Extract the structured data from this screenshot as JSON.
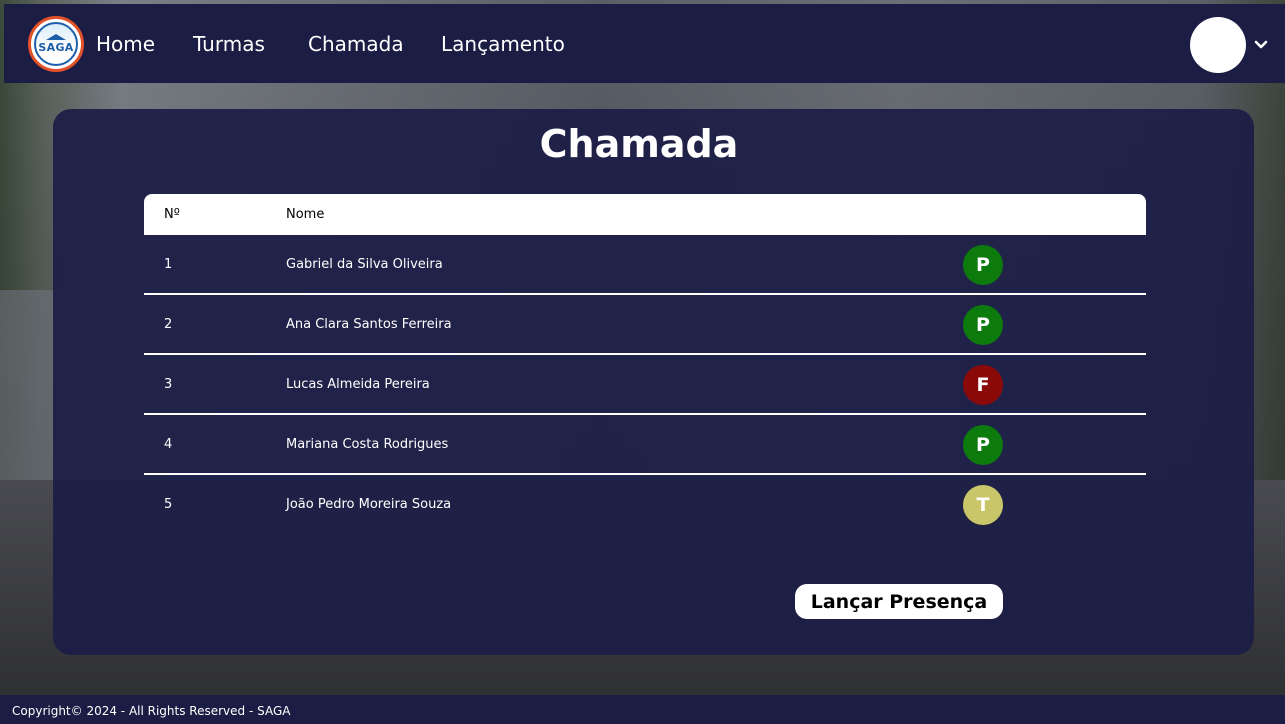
{
  "nav": {
    "logo_text": "SAGA",
    "links": [
      "Home",
      "Turmas",
      "Chamada",
      "Lançamento"
    ]
  },
  "page": {
    "title": "Chamada"
  },
  "table": {
    "headers": {
      "num": "Nº",
      "name": "Nome"
    },
    "rows": [
      {
        "num": "1",
        "name": "Gabriel da Silva Oliveira",
        "status": "P"
      },
      {
        "num": "2",
        "name": "Ana Clara Santos Ferreira",
        "status": "P"
      },
      {
        "num": "3",
        "name": "Lucas Almeida Pereira",
        "status": "F"
      },
      {
        "num": "4",
        "name": "Mariana Costa Rodrigues",
        "status": "P"
      },
      {
        "num": "5",
        "name": "João Pedro Moreira Souza",
        "status": "T"
      }
    ]
  },
  "status_colors": {
    "P": "#0d7a0d",
    "F": "#8a0a0a",
    "T": "#c9c66a"
  },
  "actions": {
    "submit_label": "Lançar Presença"
  },
  "footer": {
    "text": "Copyright© 2024 - All Rights Reserved - SAGA"
  },
  "colors": {
    "navbar": "#1c1d45",
    "panel": "#1c1d46"
  },
  "icons": {
    "user_menu": "chevron-down-icon",
    "avatar": "avatar"
  }
}
